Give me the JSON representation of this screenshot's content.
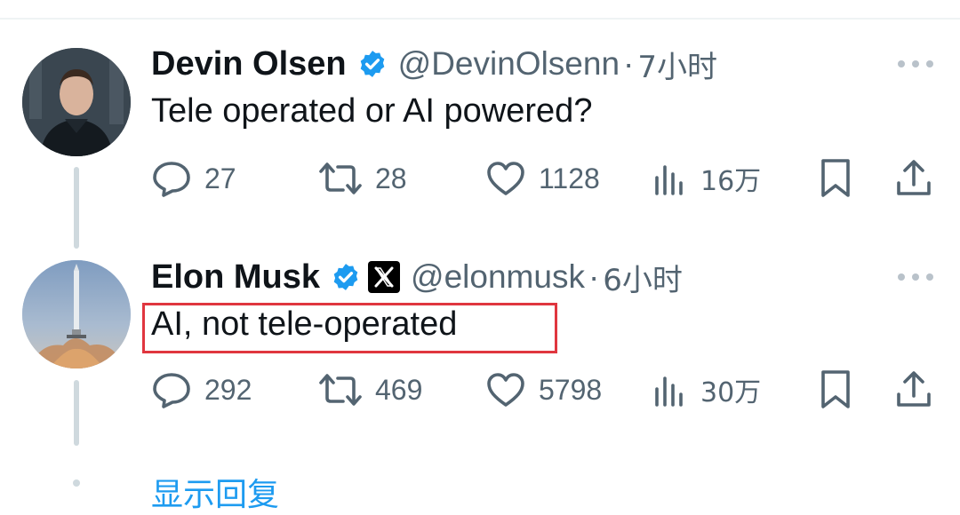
{
  "tweets": [
    {
      "name": "Devin Olsen",
      "handle": "@DevinOlsenn",
      "separator": "·",
      "time": "7小时",
      "text": "Tele operated or AI powered?",
      "stats": {
        "replies": "27",
        "retweets": "28",
        "likes": "1128",
        "views": "16万"
      }
    },
    {
      "name": "Elon Musk",
      "handle": "@elonmusk",
      "separator": "·",
      "time": "6小时",
      "text": "AI, not tele-operated",
      "stats": {
        "replies": "292",
        "retweets": "469",
        "likes": "5798",
        "views": "30万"
      }
    }
  ],
  "show_replies": "显示回复",
  "colors": {
    "verified_blue": "#1d9bf0",
    "highlight_red": "#e0363f",
    "muted_gray": "#536471",
    "text_dark": "#0f1419"
  },
  "icons": [
    "reply-icon",
    "retweet-icon",
    "like-icon",
    "views-icon",
    "bookmark-icon",
    "share-icon",
    "verified-badge-icon",
    "x-logo-icon",
    "more-icon"
  ]
}
